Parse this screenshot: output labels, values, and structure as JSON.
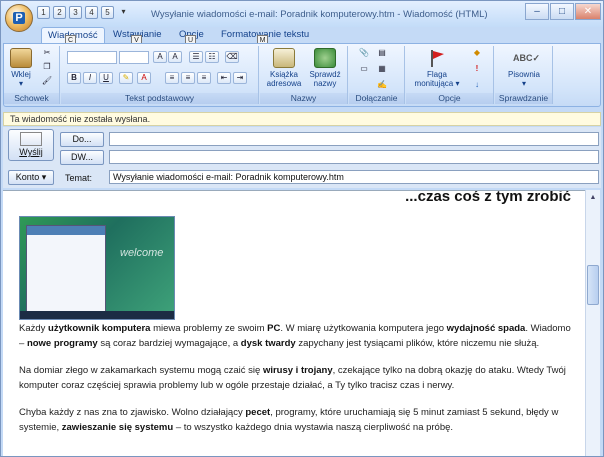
{
  "window": {
    "title": "Wysyłanie wiadomości e-mail: Poradnik komputerowy.htm - Wiadomość (HTML)",
    "orb_key": "P",
    "qat_keys": [
      "1",
      "2",
      "3",
      "4",
      "5"
    ],
    "minimize": "–",
    "maximize": "□",
    "close": "✕"
  },
  "tabs": [
    {
      "label": "Wiadomość",
      "key": "C"
    },
    {
      "label": "Wstawianie",
      "key": "V"
    },
    {
      "label": "Opcje",
      "key": "U"
    },
    {
      "label": "Formatowanie tekstu",
      "key": "M"
    }
  ],
  "ribbon": {
    "groups": {
      "schowek": "Schowek",
      "tekst": "Tekst podstawowy",
      "nazwy": "Nazwy",
      "dolaczanie": "Dołączanie",
      "opcje": "Opcje",
      "sprawdzanie": "Sprawdzanie"
    },
    "wklej": "Wklej",
    "ksiazka": [
      "Książka",
      "adresowa"
    ],
    "sprawdz": [
      "Sprawdź",
      "nazwy"
    ],
    "flaga": [
      "Flaga",
      "monitująca"
    ],
    "pisownia": "Pisownia",
    "format_b": "B",
    "format_i": "I",
    "format_u": "U"
  },
  "message_bar": "Ta wiadomość nie została wysłana.",
  "header": {
    "send": "Wyślij",
    "to_button": "Do...",
    "cc_button": "DW...",
    "account": "Konto",
    "subject_label": "Temat:",
    "to_value": "",
    "cc_value": "",
    "subject_value": "Wysyłanie wiadomości e-mail: Poradnik komputerowy.htm"
  },
  "body": {
    "heading": "...czas coś z tym zrobić",
    "shot_label": "welcome",
    "p1": [
      "Każdy ",
      "użytkownik komputera",
      " miewa problemy ze swoim ",
      "PC",
      ". W miarę użytkowania komputera jego ",
      "wydajność spada",
      ". Wiadomo – ",
      "nowe programy",
      " są coraz bardziej wymagające, a ",
      "dysk twardy",
      " zapychany jest tysiącami plików, które niczemu nie służą."
    ],
    "p2": [
      "Na domiar złego w zakamarkach systemu mogą czaić się ",
      "wirusy i trojany",
      ", czekające tylko na dobrą okazję do ataku. Wtedy Twój komputer coraz częściej sprawia problemy lub w ogóle przestaje działać, a Ty tylko tracisz czas i nerwy."
    ],
    "p3": [
      "Chyba każdy z nas zna to zjawisko. Wolno działający ",
      "pecet",
      ", programy, które uruchamiają się 5 minut zamiast 5 sekund, błędy w systemie, ",
      "zawieszanie się systemu",
      " – to wszystko każdego dnia wystawia naszą cierpliwość na próbę."
    ]
  }
}
